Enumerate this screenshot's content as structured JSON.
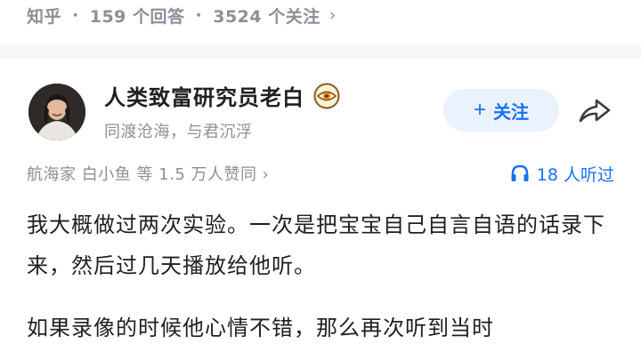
{
  "question_meta": {
    "source": "知乎",
    "answers": "159 个回答",
    "followers": "3524 个关注"
  },
  "author": {
    "name": "人类致富研究员老白",
    "bio": "同渡沧海，与君沉浮",
    "badge_icon": "eye-badge-icon"
  },
  "actions": {
    "follow_label": "关注",
    "share_icon": "share-icon"
  },
  "answer_meta": {
    "upvotes": "航海家 白小鱼 等 1.5 万人赞同",
    "listeners": "18 人听过"
  },
  "content": {
    "paragraphs": [
      "我大概做过两次实验。一次是把宝宝自己自言自语的话录下来，然后过几天播放给他听。",
      "如果录像的时候他心情不错，那么再次听到当时"
    ]
  },
  "colors": {
    "accent": "#1772f6",
    "muted": "#8a8f99",
    "text": "#1f1f1f",
    "follow_bg": "#eaf2fe"
  }
}
